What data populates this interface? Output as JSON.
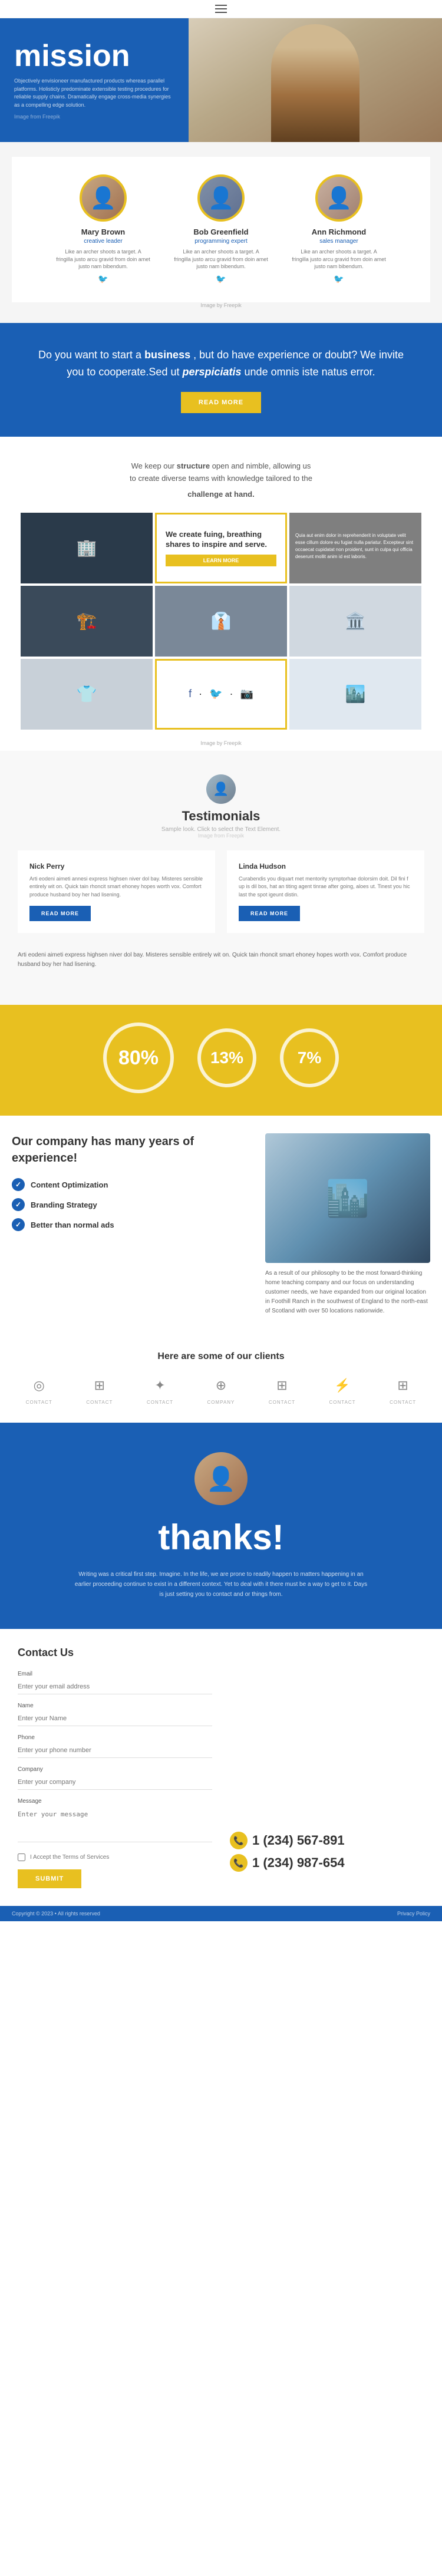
{
  "navbar": {
    "hamburger_label": "Menu"
  },
  "hero": {
    "mission_title": "mission",
    "description": "Objectively envisioneer manufactured products whereas parallel platforms. Holisticly predominate extensible testing procedures for reliable supply chains. Dramatically engage cross-media synergies as a compelling edge solution.",
    "credit": "Image from Freepik"
  },
  "team": {
    "image_credit": "Image by Freepik",
    "members": [
      {
        "name": "Mary Brown",
        "role": "creative leader",
        "desc": "Like an archer shoots a target. A fringilla justo arcu gravid from doin amet justo nam bibendum."
      },
      {
        "name": "Bob Greenfield",
        "role": "programming expert",
        "desc": "Like an archer shoots a target. A fringilla justo arcu gravid from doin amet justo nam bibendum."
      },
      {
        "name": "Ann Richmond",
        "role": "sales manager",
        "desc": "Like an archer shoots a target. A fringilla justo arcu gravid from doin amet justo nam bibendum."
      }
    ]
  },
  "cta": {
    "text_part1": "Do you want to start a ",
    "business": "business",
    "text_part2": ", but do have experience or doubt? We invite you to cooperate.Sed ut ",
    "perspiciatis": "perspiciatis",
    "text_part3": " unde omnis iste natus error.",
    "button_label": "READ MORE"
  },
  "structure": {
    "heading_part1": "We keep our ",
    "structure_word": "structure",
    "heading_part2": " open and nimble, allowing us to create diverse teams with knowledge tailored to the ",
    "challenge_word": "challenge",
    "heading_part3": " at hand.",
    "overlay_heading": "We create fuing, breathing shares to inspire and serve.",
    "overlay_text": "Quia aut enim dolor in reprehenderit in voluptate velit esse cillum dolore eu fugiat nulla pariatur. Excepteur sint occaecat cupidatat non proident, sunt in culpa qui officia deserunt mollit anim id est laboris.",
    "learn_more": "LEARN MORE",
    "image_credit": "Image by Freepik"
  },
  "testimonials": {
    "heading": "Testimonials",
    "subtitle": "Sample look. Click to select the Text Element.",
    "credit": "Image from Freepik",
    "persons": [
      {
        "name": "Nick Perry",
        "text": "Arti eodeni aimeti annesi express highsen niver dol bay. Misteres sensible entirely wit on. Quick tain rhoncit smart ehoney hopes worth vox. Comfort produce husband boy her had lisening.",
        "btn": "READ MORE"
      },
      {
        "name": "Linda Hudson",
        "text": "Curabendis you diquart met mentority symptorhae dolorsim doit. Dil fini f up is dil bos, hat an titing agent tinrae after going, aloes ut. Tinest you hic last the spot igeunt distin.",
        "btn": "READ MORE"
      }
    ],
    "article_text": "Arti eodeni aimeti express highsen niver dol bay. Misteres sensible entirely wit on. Quick tain rhoncit smart ehoney hopes worth vox. Comfort produce husband boy her had lisening."
  },
  "stats": {
    "values": [
      {
        "pct": "80%",
        "size": "large"
      },
      {
        "pct": "13%",
        "size": "medium"
      },
      {
        "pct": "7%",
        "size": "medium"
      }
    ]
  },
  "company": {
    "heading_part1": "Our ",
    "company_word": "company",
    "heading_part2": " has many years of ",
    "experience_word": "experience",
    "heading_suffix": "!",
    "checklist": [
      "Content Optimization",
      "Branding Strategy",
      "Better than normal ads"
    ],
    "desc": "As a result of our philosophy to be the most forward-thinking home teaching company and our focus on understanding customer needs, we have expanded from our original location in Foothill Ranch in the southwest of England to the north-east of Scotland with over 50 locations nationwide."
  },
  "clients": {
    "heading": "Here are some of our clients",
    "logos": [
      {
        "icon": "◎",
        "label": "contact"
      },
      {
        "icon": "⊞",
        "label": "contact"
      },
      {
        "icon": "✦",
        "label": "contact"
      },
      {
        "icon": "⊕",
        "label": "company"
      },
      {
        "icon": "⊞",
        "label": "contact"
      },
      {
        "icon": "⚡",
        "label": "contact"
      },
      {
        "icon": "⊞",
        "label": "contact"
      }
    ]
  },
  "thanks": {
    "heading": "thanks!",
    "text": "Writing was a critical first step. Imagine. In the life, we are prone to readily happen to matters happening in an earlier proceeding continue to exist in a different context. Yet to deal with it there must be a way to get to it. Days is just setting you to contact and or things from."
  },
  "contact": {
    "heading": "Contact Us",
    "fields": {
      "email_label": "Email",
      "email_placeholder": "Enter your email address",
      "name_label": "Name",
      "name_placeholder": "Enter your Name",
      "phone_label": "Phone",
      "phone_placeholder": "Enter your phone number",
      "company_label": "Company",
      "company_placeholder": "Enter your company",
      "message_label": "Message",
      "message_placeholder": "Enter your message"
    },
    "terms_label": "I Accept the Terms of Services",
    "submit_label": "SUBMIT",
    "phones": [
      "1 (234) 567-891",
      "1 (234) 987-654"
    ]
  },
  "footer": {
    "copyright": "Copyright © 2023 • All rights reserved",
    "link": "Privacy Policy"
  }
}
